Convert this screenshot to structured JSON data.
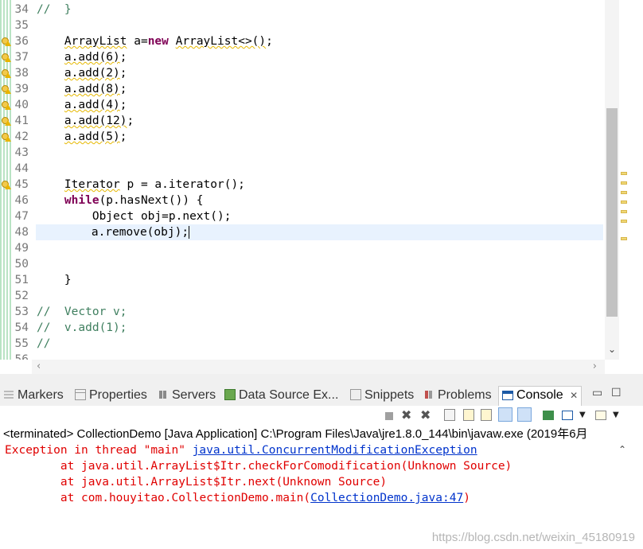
{
  "editor": {
    "lines": [
      {
        "n": "34",
        "html_parts": [
          {
            "cls": "cm",
            "t": "//  }"
          }
        ]
      },
      {
        "n": "35",
        "html_parts": []
      },
      {
        "n": "36",
        "marker": true,
        "html_parts": [
          {
            "cls": "",
            "t": "    "
          },
          {
            "cls": "squig",
            "t": "ArrayList"
          },
          {
            "cls": "",
            "t": " a="
          },
          {
            "cls": "kw",
            "t": "new"
          },
          {
            "cls": "",
            "t": " "
          },
          {
            "cls": "squig",
            "t": "ArrayList<>()"
          },
          {
            "cls": "",
            "t": ";"
          }
        ]
      },
      {
        "n": "37",
        "marker": true,
        "html_parts": [
          {
            "cls": "",
            "t": "    "
          },
          {
            "cls": "squig",
            "t": "a.add(6)"
          },
          {
            "cls": "",
            "t": ";"
          }
        ]
      },
      {
        "n": "38",
        "marker": true,
        "html_parts": [
          {
            "cls": "",
            "t": "    "
          },
          {
            "cls": "squig",
            "t": "a.add(2)"
          },
          {
            "cls": "",
            "t": ";"
          }
        ]
      },
      {
        "n": "39",
        "marker": true,
        "html_parts": [
          {
            "cls": "",
            "t": "    "
          },
          {
            "cls": "squig",
            "t": "a.add(8)"
          },
          {
            "cls": "",
            "t": ";"
          }
        ]
      },
      {
        "n": "40",
        "marker": true,
        "html_parts": [
          {
            "cls": "",
            "t": "    "
          },
          {
            "cls": "squig",
            "t": "a.add(4)"
          },
          {
            "cls": "",
            "t": ";"
          }
        ]
      },
      {
        "n": "41",
        "marker": true,
        "html_parts": [
          {
            "cls": "",
            "t": "    "
          },
          {
            "cls": "squig",
            "t": "a.add(12)"
          },
          {
            "cls": "",
            "t": ";"
          }
        ]
      },
      {
        "n": "42",
        "marker": true,
        "html_parts": [
          {
            "cls": "",
            "t": "    "
          },
          {
            "cls": "squig",
            "t": "a.add(5)"
          },
          {
            "cls": "",
            "t": ";"
          }
        ]
      },
      {
        "n": "43",
        "html_parts": []
      },
      {
        "n": "44",
        "html_parts": []
      },
      {
        "n": "45",
        "marker": true,
        "html_parts": [
          {
            "cls": "",
            "t": "    "
          },
          {
            "cls": "squig",
            "t": "Iterator"
          },
          {
            "cls": "",
            "t": " p = a.iterator();"
          }
        ]
      },
      {
        "n": "46",
        "html_parts": [
          {
            "cls": "",
            "t": "    "
          },
          {
            "cls": "kw",
            "t": "while"
          },
          {
            "cls": "",
            "t": "(p.hasNext()) {"
          }
        ]
      },
      {
        "n": "47",
        "html_parts": [
          {
            "cls": "",
            "t": "        Object "
          },
          {
            "cls": "",
            "t": "obj"
          },
          {
            "cls": "",
            "t": "=p.next();"
          }
        ]
      },
      {
        "n": "48",
        "current": true,
        "html_parts": [
          {
            "cls": "",
            "t": "        a.remove("
          },
          {
            "cls": "",
            "t": "obj"
          },
          {
            "cls": "",
            "t": ");"
          }
        ]
      },
      {
        "n": "49",
        "html_parts": []
      },
      {
        "n": "50",
        "html_parts": []
      },
      {
        "n": "51",
        "html_parts": [
          {
            "cls": "",
            "t": "    }"
          }
        ]
      },
      {
        "n": "52",
        "html_parts": []
      },
      {
        "n": "53",
        "html_parts": [
          {
            "cls": "cm",
            "t": "//  Vector v;"
          }
        ]
      },
      {
        "n": "54",
        "html_parts": [
          {
            "cls": "cm",
            "t": "//  v.add(1);"
          }
        ]
      },
      {
        "n": "55",
        "html_parts": [
          {
            "cls": "cm",
            "t": "//"
          }
        ]
      },
      {
        "n": "56",
        "html_parts": []
      }
    ]
  },
  "panel": {
    "tabs": [
      {
        "label": "Markers",
        "icon": "markers-icon"
      },
      {
        "label": "Properties",
        "icon": "properties-icon"
      },
      {
        "label": "Servers",
        "icon": "servers-icon"
      },
      {
        "label": "Data Source Ex...",
        "icon": "data-source-icon"
      },
      {
        "label": "Snippets",
        "icon": "snippets-icon"
      },
      {
        "label": "Problems",
        "icon": "problems-icon"
      },
      {
        "label": "Console",
        "icon": "console-icon",
        "active": true,
        "close": "✕"
      }
    ],
    "minimize": "▭",
    "maximize": "☐",
    "status": "<terminated> CollectionDemo [Java Application] C:\\Program Files\\Java\\jre1.8.0_144\\bin\\javaw.exe (2019年6月",
    "console": {
      "line1_prefix": "Exception in thread \"main\" ",
      "line1_link": "java.util.ConcurrentModificationException",
      "line2": "\tat java.util.ArrayList$Itr.checkForComodification(Unknown Source)",
      "line3": "\tat java.util.ArrayList$Itr.next(Unknown Source)",
      "line4_prefix": "\tat com.houyitao.CollectionDemo.main(",
      "line4_link": "CollectionDemo.java:47",
      "line4_suffix": ")"
    },
    "watermark": "https://blog.csdn.net/weixin_45180919"
  }
}
